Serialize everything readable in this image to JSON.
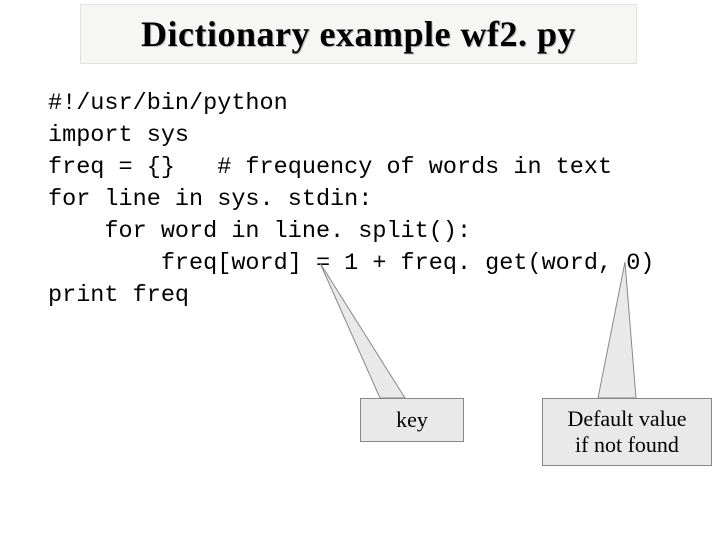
{
  "title": "Dictionary example wf2. py",
  "code": "#!/usr/bin/python\nimport sys\nfreq = {}   # frequency of words in text\nfor line in sys. stdin:\n    for word in line. split():\n        freq[word] = 1 + freq. get(word, 0)\nprint freq",
  "callouts": {
    "key": "key",
    "default": "Default value\nif not found"
  }
}
